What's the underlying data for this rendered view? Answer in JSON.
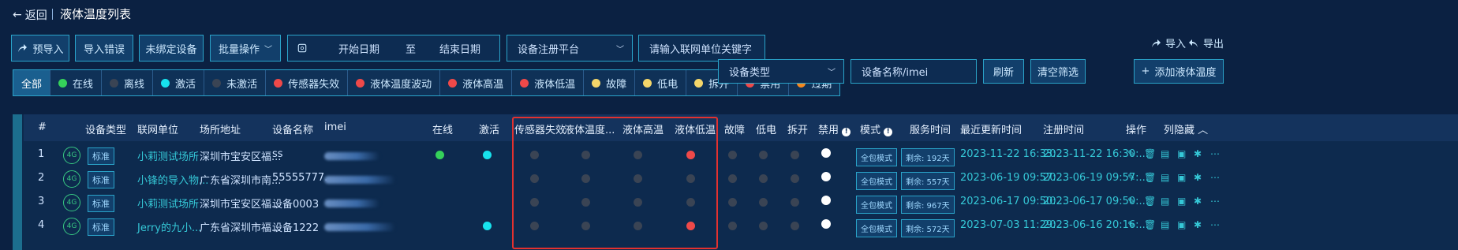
{
  "header": {
    "back_label": "返回",
    "title": "液体温度列表"
  },
  "toolbar": {
    "pre_import": "预导入",
    "import_error": "导入错误",
    "unbound": "未绑定设备",
    "batch": "批量操作",
    "start_date": "开始日期",
    "to": "至",
    "end_date": "结束日期",
    "platform_placeholder": "设备注册平台",
    "unit_placeholder": "请输入联网单位关键字",
    "import": "导入",
    "export": "导出"
  },
  "filters": {
    "tabs": [
      {
        "label": "全部",
        "color": ""
      },
      {
        "label": "在线",
        "color": "#35d15a"
      },
      {
        "label": "离线",
        "color": "#3a4454"
      },
      {
        "label": "激活",
        "color": "#17e3ee"
      },
      {
        "label": "未激活",
        "color": "#3a4454"
      },
      {
        "label": "传感器失效",
        "color": "#ef4949"
      },
      {
        "label": "液体温度波动",
        "color": "#ef4949"
      },
      {
        "label": "液体高温",
        "color": "#ef4949"
      },
      {
        "label": "液体低温",
        "color": "#ef4949"
      },
      {
        "label": "故障",
        "color": "#f4d66a"
      },
      {
        "label": "低电",
        "color": "#f4d66a"
      },
      {
        "label": "拆开",
        "color": "#f4d66a"
      },
      {
        "label": "禁用",
        "color": "#ef4949"
      },
      {
        "label": "过期",
        "color": "#f5891f"
      }
    ],
    "device_type_placeholder": "设备类型",
    "name_placeholder": "设备名称/imei",
    "refresh": "刷新",
    "clear": "清空筛选",
    "add": "添加液体温度"
  },
  "table": {
    "headers": {
      "no": "#",
      "type": "设备类型",
      "unit": "联网单位",
      "addr": "场所地址",
      "name": "设备名称",
      "imei": "imei",
      "online": "在线",
      "active": "激活",
      "sensor": "传感器失效",
      "fluct": "液体温度...",
      "high": "液体高温",
      "low": "液体低温",
      "fault": "故障",
      "lowbat": "低电",
      "open": "拆开",
      "disabled": "禁用",
      "mode": "模式",
      "service": "服务时间",
      "updated": "最近更新时间",
      "registered": "注册时间",
      "ops": "操作",
      "hide_cols": "列隐藏"
    },
    "rows": [
      {
        "no": "1",
        "net": "4G",
        "type": "标准",
        "unit": "小莉测试场所",
        "addr": "深圳市宝安区福...",
        "name": "ss",
        "imei": "",
        "online": "#35d15a",
        "active": "#17e3ee",
        "sensor": "#3a4454",
        "fluct": "#3a4454",
        "high": "#3a4454",
        "low": "#ef4949",
        "fault": "#3a4454",
        "lowbat": "#3a4454",
        "open": "#3a4454",
        "mode": "全包模式",
        "remain": "剩余: 192天",
        "updated": "2023-11-22 16:33:...",
        "registered": "2023-11-22 16:30:..."
      },
      {
        "no": "2",
        "net": "4G",
        "type": "标准",
        "unit": "小锋的导入物...",
        "addr": "广东省深圳市南...",
        "name": "55555777...",
        "imei": "",
        "online": "",
        "active": "",
        "sensor": "#3a4454",
        "fluct": "#3a4454",
        "high": "#3a4454",
        "low": "#3a4454",
        "fault": "#3a4454",
        "lowbat": "#3a4454",
        "open": "#3a4454",
        "mode": "全包模式",
        "remain": "剩余: 557天",
        "updated": "2023-06-19 09:57:...",
        "registered": "2023-06-19 09:57:..."
      },
      {
        "no": "3",
        "net": "4G",
        "type": "标准",
        "unit": "小莉测试场所",
        "addr": "深圳市宝安区福...",
        "name": "设备0003",
        "imei": "",
        "online": "",
        "active": "",
        "sensor": "#3a4454",
        "fluct": "#3a4454",
        "high": "#3a4454",
        "low": "#3a4454",
        "fault": "#3a4454",
        "lowbat": "#3a4454",
        "open": "#3a4454",
        "mode": "全包模式",
        "remain": "剩余: 967天",
        "updated": "2023-06-17 09:50:...",
        "registered": "2023-06-17 09:50:..."
      },
      {
        "no": "4",
        "net": "4G",
        "type": "标准",
        "unit": "Jerry的九小...",
        "addr": "广东省深圳市福...",
        "name": "设备1222",
        "imei": "",
        "online": "",
        "active": "#17e3ee",
        "sensor": "#3a4454",
        "fluct": "#3a4454",
        "high": "#3a4454",
        "low": "#ef4949",
        "fault": "#3a4454",
        "lowbat": "#3a4454",
        "open": "#3a4454",
        "mode": "全包模式",
        "remain": "剩余: 572天",
        "updated": "2023-07-03 11:29:...",
        "registered": "2023-06-16 20:16:..."
      }
    ]
  }
}
